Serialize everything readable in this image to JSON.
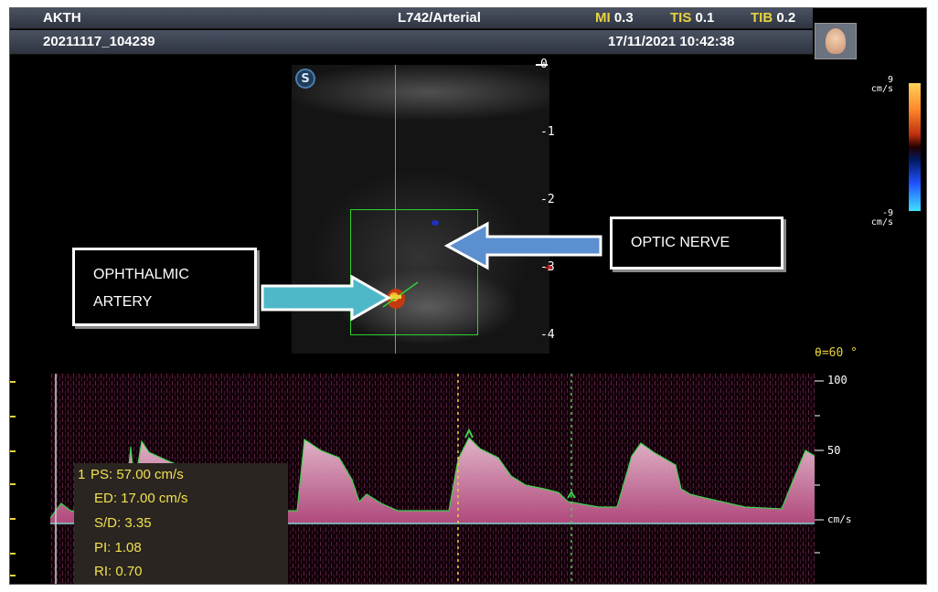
{
  "header": {
    "patient": "AKTH",
    "probe_preset": "L742/Arterial",
    "mi_label": "MI",
    "mi_value": "0.3",
    "tis_label": "TIS",
    "tis_value": "0.1",
    "tib_label": "TIB",
    "tib_value": "0.2",
    "study_id": "20211117_104239",
    "datetime": "17/11/2021 10:42:38"
  },
  "depth_scale": [
    "0",
    "-1",
    "-2",
    "-3",
    "-4"
  ],
  "velocity_scale": {
    "top_value": "9",
    "top_unit": "cm/s",
    "bottom_value": "-9",
    "bottom_unit": "cm/s"
  },
  "annotations": {
    "optic_nerve": "OPTIC NERVE",
    "ophthalmic_line1": "OPHTHALMIC",
    "ophthalmic_line2": "ARTERY"
  },
  "angle": "θ=60 °",
  "spectral_scale": {
    "top": "100",
    "mid": "50",
    "unit": "cm/s"
  },
  "measurements": {
    "index": "1",
    "ps": "PS: 57.00  cm/s",
    "ed": "ED: 17.00  cm/s",
    "sd": "S/D: 3.35",
    "pi": "PI: 1.08",
    "ri": "RI: 0.70"
  },
  "colors": {
    "header_bg": "#3a4150",
    "accent_yellow": "#e9d33c",
    "doppler_pink": "#e8a8c8",
    "roi_green": "#2fd12f",
    "arrow_blue": "#5b8fd0",
    "arrow_cyan": "#4fb8c8"
  },
  "icons": [
    "s-logo-icon",
    "patient-avatar-icon",
    "arrow-left-icon",
    "arrow-right-icon"
  ]
}
